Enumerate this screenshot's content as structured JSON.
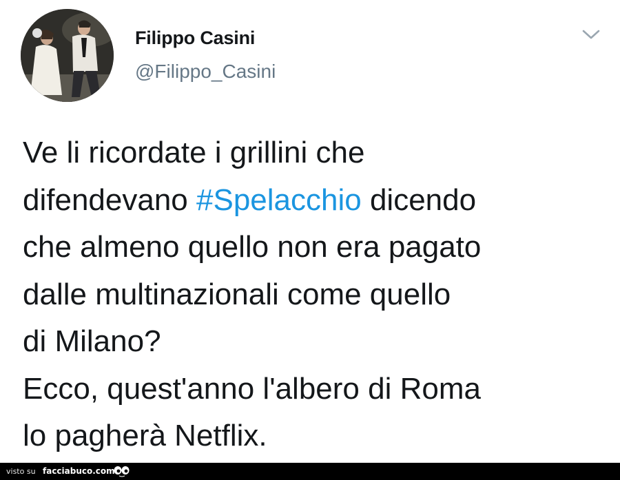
{
  "tweet": {
    "author_name": "Filippo Casini",
    "author_handle": "@Filippo_Casini",
    "menu_icon": "chevron-down-icon",
    "text_lines": [
      {
        "before": "Ve li ricordate i grillini che",
        "hashtag": "",
        "after": ""
      },
      {
        "before": "difendevano ",
        "hashtag": "#Spelacchio",
        "after": " dicendo"
      },
      {
        "before": "che almeno quello non era pagato",
        "hashtag": "",
        "after": ""
      },
      {
        "before": "dalle multinazionali come quello",
        "hashtag": "",
        "after": ""
      },
      {
        "before": "di Milano?",
        "hashtag": "",
        "after": ""
      },
      {
        "before": "Ecco, quest'anno l'albero di Roma",
        "hashtag": "",
        "after": ""
      },
      {
        "before": "lo pagherà Netflix.",
        "hashtag": "",
        "after": ""
      }
    ]
  },
  "footer": {
    "visto_su": "visto su",
    "site": "facciabuco.com",
    "logo_icon": "eyes-icon"
  },
  "colors": {
    "text": "#14171a",
    "handle": "#657786",
    "hashtag": "#1b95e0",
    "footer_bg": "#000000"
  }
}
